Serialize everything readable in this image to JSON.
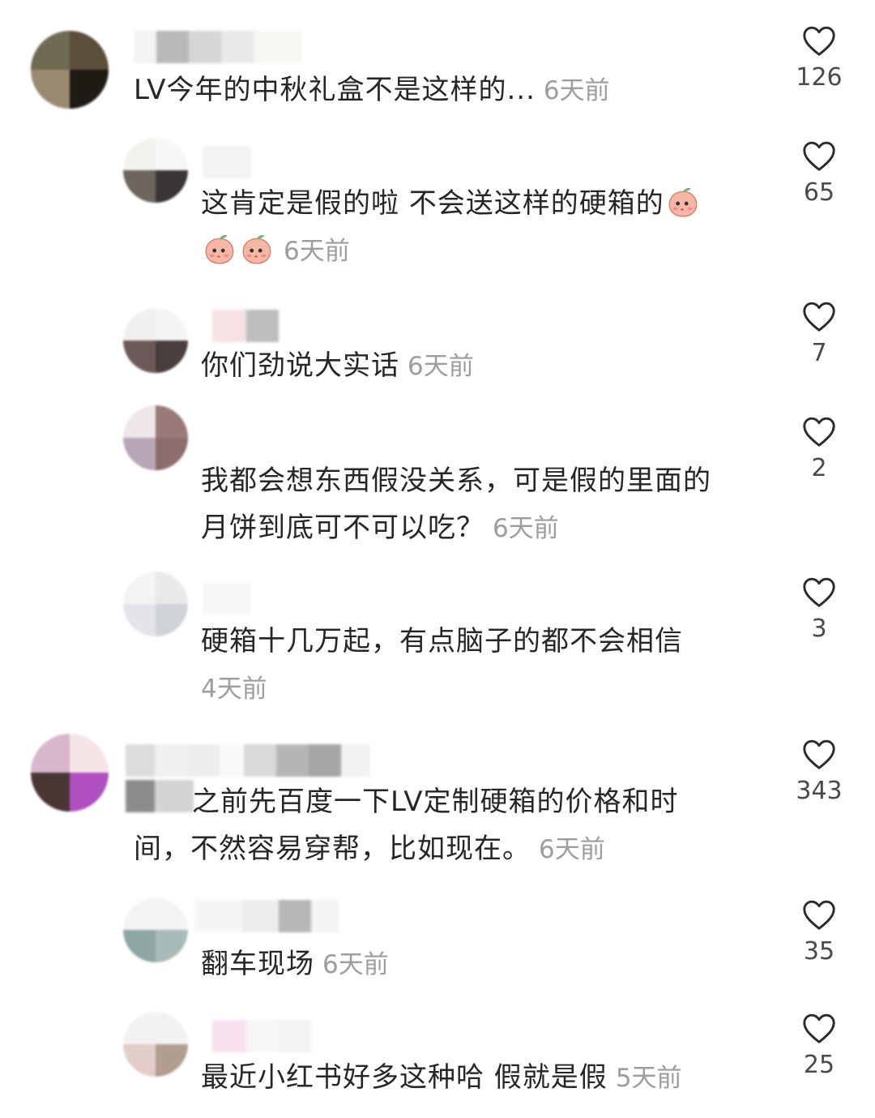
{
  "comments": [
    {
      "id": "c1",
      "text": "LV今年的中秋礼盒不是这样的...",
      "time": "6天前",
      "likes": "126",
      "level": "top"
    },
    {
      "id": "c2",
      "text": "这肯定是假的啦 不会送这样的硬箱的",
      "time": "6天前",
      "likes": "65",
      "level": "reply",
      "emoji": "blushing-peach-emoji"
    },
    {
      "id": "c3",
      "text": "你们劲说大实话",
      "time": "6天前",
      "likes": "7",
      "level": "reply"
    },
    {
      "id": "c4",
      "text_line1": "我都会想东西假没关系，可是假的里面的",
      "text_line2": "月饼到底可不可以吃？",
      "time": "6天前",
      "likes": "2",
      "level": "reply"
    },
    {
      "id": "c5",
      "text": "硬箱十几万起，有点脑子的都不会相信",
      "time": "4天前",
      "likes": "3",
      "level": "reply"
    },
    {
      "id": "c6",
      "text_line1": "之前先百度一下LV定制硬箱的价格和时",
      "text_line2": "间，不然容易穿帮，比如现在。",
      "time": "6天前",
      "likes": "343",
      "level": "top"
    },
    {
      "id": "c7",
      "text": "翻车现场",
      "time": "6天前",
      "likes": "35",
      "level": "reply"
    },
    {
      "id": "c8",
      "text": "最近小红书好多这种哈 假就是假",
      "time": "5天前",
      "likes": "25",
      "level": "reply"
    }
  ],
  "icons": {
    "like": "heart-outline-icon",
    "emoji": "blushing-peach-emoji"
  },
  "colors": {
    "text": "#262626",
    "time": "#9d9d9d",
    "count": "#4a4a4a"
  }
}
